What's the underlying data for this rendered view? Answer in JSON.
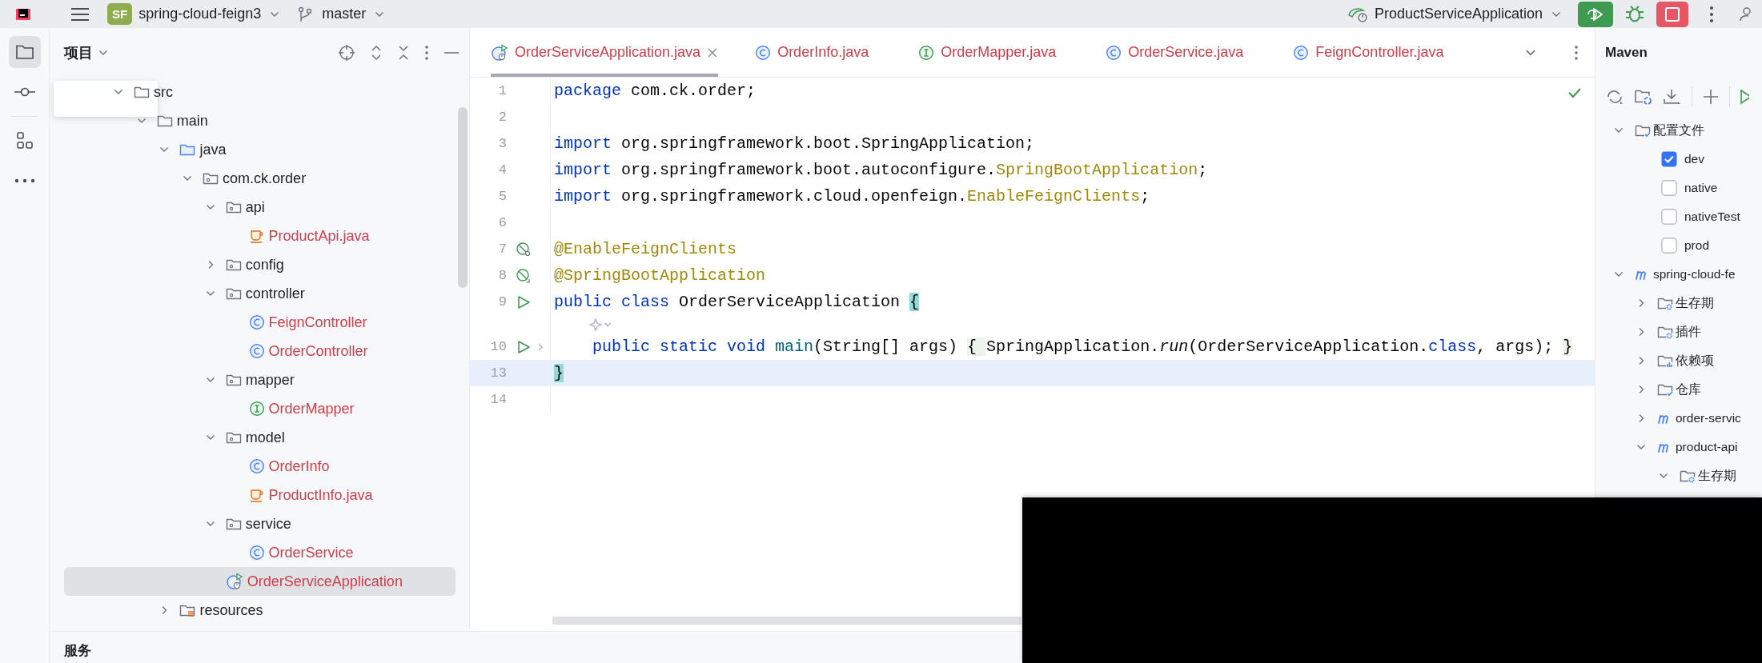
{
  "toolbar": {
    "project_badge": "SF",
    "project": "spring-cloud-feign3",
    "branch": "master",
    "run_config": "ProductServiceApplication"
  },
  "side_strip": [
    {
      "kind": "folder",
      "selected": true
    },
    {
      "kind": "commit",
      "selected": false
    },
    {
      "kind": "structure",
      "selected": false
    },
    {
      "kind": "more",
      "selected": false
    }
  ],
  "project_panel": {
    "title": "项目",
    "tree": [
      {
        "label": "src",
        "kind": "folder",
        "expanded": true,
        "selected": false,
        "unversioned": false,
        "children": [
          {
            "label": "main",
            "kind": "folder",
            "expanded": true,
            "selected": false,
            "unversioned": false,
            "children": [
              {
                "label": "java",
                "kind": "source-folder",
                "expanded": true,
                "selected": false,
                "unversioned": false,
                "children": [
                  {
                    "label": "com.ck.order",
                    "kind": "package",
                    "expanded": true,
                    "selected": false,
                    "unversioned": false,
                    "children": [
                      {
                        "label": "api",
                        "kind": "package",
                        "expanded": true,
                        "selected": false,
                        "unversioned": false,
                        "children": [
                          {
                            "label": "ProductApi.java",
                            "kind": "java-file",
                            "selected": false,
                            "unversioned": true
                          }
                        ]
                      },
                      {
                        "label": "config",
                        "kind": "package",
                        "expanded": false,
                        "selected": false,
                        "unversioned": false
                      },
                      {
                        "label": "controller",
                        "kind": "package",
                        "expanded": true,
                        "selected": false,
                        "unversioned": false,
                        "children": [
                          {
                            "label": "FeignController",
                            "kind": "class",
                            "selected": false,
                            "unversioned": true
                          },
                          {
                            "label": "OrderController",
                            "kind": "class",
                            "selected": false,
                            "unversioned": true
                          }
                        ]
                      },
                      {
                        "label": "mapper",
                        "kind": "package",
                        "expanded": true,
                        "selected": false,
                        "unversioned": false,
                        "children": [
                          {
                            "label": "OrderMapper",
                            "kind": "interface",
                            "selected": false,
                            "unversioned": true
                          }
                        ]
                      },
                      {
                        "label": "model",
                        "kind": "package",
                        "expanded": true,
                        "selected": false,
                        "unversioned": false,
                        "children": [
                          {
                            "label": "OrderInfo",
                            "kind": "class",
                            "selected": false,
                            "unversioned": true
                          },
                          {
                            "label": "ProductInfo.java",
                            "kind": "java-file",
                            "selected": false,
                            "unversioned": true
                          }
                        ]
                      },
                      {
                        "label": "service",
                        "kind": "package",
                        "expanded": true,
                        "selected": false,
                        "unversioned": false,
                        "children": [
                          {
                            "label": "OrderService",
                            "kind": "class",
                            "selected": false,
                            "unversioned": true
                          }
                        ]
                      },
                      {
                        "label": "OrderServiceApplication",
                        "kind": "app-class",
                        "selected": true,
                        "unversioned": true
                      }
                    ]
                  }
                ]
              },
              {
                "label": "resources",
                "kind": "resources-folder",
                "expanded": false,
                "selected": false,
                "unversioned": false
              }
            ]
          }
        ]
      }
    ]
  },
  "editor": {
    "tabs": [
      {
        "label": "OrderServiceApplication.java",
        "kind": "app-class",
        "selected": true,
        "unversioned": true
      },
      {
        "label": "OrderInfo.java",
        "kind": "class",
        "selected": false,
        "unversioned": true
      },
      {
        "label": "OrderMapper.java",
        "kind": "interface",
        "selected": false,
        "unversioned": true
      },
      {
        "label": "OrderService.java",
        "kind": "class",
        "selected": false,
        "unversioned": true
      },
      {
        "label": "FeignController.java",
        "kind": "class",
        "selected": false,
        "unversioned": true
      }
    ],
    "lines": [
      {
        "kind": "plain",
        "number": "1",
        "current": false,
        "tokens": [
          {
            "kind": "keyword",
            "text": "package"
          },
          {
            "kind": "plain",
            "text": " com.ck.order;"
          }
        ]
      },
      {
        "kind": "plain",
        "number": "2",
        "current": false
      },
      {
        "kind": "plain",
        "number": "3",
        "current": false,
        "tokens": [
          {
            "kind": "keyword",
            "text": "import"
          },
          {
            "kind": "plain",
            "text": " org.springframework.boot.SpringApplication;"
          }
        ]
      },
      {
        "kind": "plain",
        "number": "4",
        "current": false,
        "tokens": [
          {
            "kind": "keyword",
            "text": "import"
          },
          {
            "kind": "plain",
            "text": " org.springframework.boot.autoconfigure."
          },
          {
            "kind": "annotation",
            "text": "SpringBootApplication"
          },
          {
            "kind": "plain",
            "text": ";"
          }
        ]
      },
      {
        "kind": "plain",
        "number": "5",
        "current": false,
        "tokens": [
          {
            "kind": "keyword",
            "text": "import"
          },
          {
            "kind": "plain",
            "text": " org.springframework.cloud.openfeign."
          },
          {
            "kind": "annotation",
            "text": "EnableFeignClients"
          },
          {
            "kind": "plain",
            "text": ";"
          }
        ]
      },
      {
        "kind": "plain",
        "number": "6",
        "current": false
      },
      {
        "kind": "bean-search",
        "number": "7",
        "current": false,
        "tokens": [
          {
            "kind": "annotation",
            "text": "@EnableFeignClients"
          }
        ]
      },
      {
        "kind": "bean",
        "number": "8",
        "current": false,
        "tokens": [
          {
            "kind": "annotation",
            "text": "@SpringBootApplication"
          }
        ]
      },
      {
        "kind": "run",
        "number": "9",
        "current": false,
        "tokens": [
          {
            "kind": "keyword",
            "text": "public class"
          },
          {
            "kind": "plain",
            "text": " OrderServiceApplication "
          },
          {
            "kind": "match",
            "text": "{"
          }
        ]
      },
      {
        "kind": "hint"
      },
      {
        "kind": "run-fold",
        "number": "10",
        "current": false,
        "tokens": [
          {
            "kind": "keyword",
            "text": "    public static void "
          },
          {
            "kind": "method",
            "text": "main"
          },
          {
            "kind": "plain",
            "text": "(String[] args) "
          },
          {
            "kind": "fold",
            "text": "{ "
          },
          {
            "kind": "plain",
            "text": "SpringApplication."
          },
          {
            "kind": "static",
            "text": "run"
          },
          {
            "kind": "plain",
            "text": "(OrderServiceApplication."
          },
          {
            "kind": "keyword",
            "text": "class"
          },
          {
            "kind": "plain",
            "text": ", args); "
          },
          {
            "kind": "fold",
            "text": "}"
          }
        ]
      },
      {
        "kind": "plain",
        "number": "13",
        "current": true,
        "tokens": [
          {
            "kind": "match",
            "text": "}"
          }
        ]
      },
      {
        "kind": "plain",
        "number": "14",
        "current": false
      }
    ]
  },
  "maven": {
    "title": "Maven",
    "tree": [
      {
        "kind": "folder-check",
        "label": "配置文件",
        "expanded": true,
        "children": [
          {
            "kind": "checkbox",
            "label": "dev",
            "checked": true
          },
          {
            "kind": "checkbox",
            "label": "native",
            "checked": false
          },
          {
            "kind": "checkbox",
            "label": "nativeTest",
            "checked": false
          },
          {
            "kind": "checkbox",
            "label": "prod",
            "checked": false
          }
        ]
      },
      {
        "kind": "module",
        "label": "spring-cloud-fe",
        "expanded": true,
        "children": [
          {
            "kind": "folder-gear",
            "label": "生存期",
            "expanded": false
          },
          {
            "kind": "folder-gear",
            "label": "插件",
            "expanded": false
          },
          {
            "kind": "folder-chart",
            "label": "依赖项",
            "expanded": false
          },
          {
            "kind": "folder-check",
            "label": "仓库",
            "expanded": false
          },
          {
            "kind": "module",
            "label": "order-servic",
            "expanded": false
          },
          {
            "kind": "module",
            "label": "product-api",
            "expanded": true,
            "children": [
              {
                "kind": "folder-gear",
                "label": "生存期",
                "expanded": true
              }
            ]
          }
        ]
      }
    ]
  },
  "bottom_panel": {
    "title": "服务"
  }
}
